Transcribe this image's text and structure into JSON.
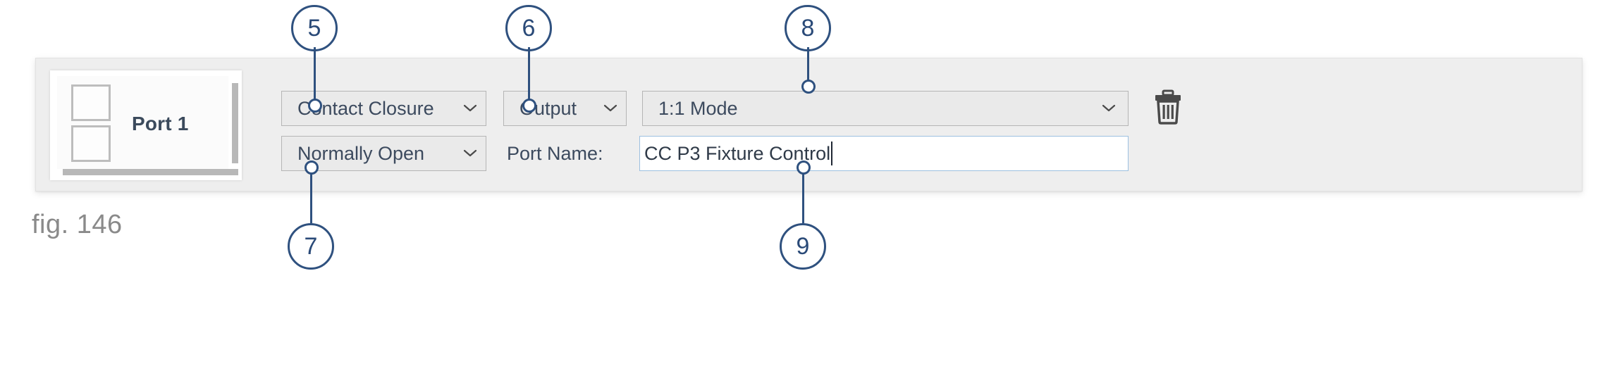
{
  "figure": {
    "caption": "fig. 146"
  },
  "panel": {
    "port_card": {
      "label": "Port 1",
      "terminal_top_name": "terminal-square-top",
      "terminal_bottom_name": "terminal-square-bottom"
    },
    "controls": {
      "type_select": {
        "value": "Contact Closure",
        "chevron": "chevron-down-icon"
      },
      "state_select": {
        "value": "Normally Open",
        "chevron": "chevron-down-icon"
      },
      "direction_select": {
        "value": "Output",
        "chevron": "chevron-down-icon"
      },
      "mode_select": {
        "value": "1:1 Mode",
        "chevron": "chevron-down-icon"
      },
      "port_name_label": "Port Name:",
      "port_name_input": {
        "value": "CC P3 Fixture Control",
        "placeholder": ""
      },
      "delete_button": {
        "icon": "trash-icon"
      }
    }
  },
  "callouts": [
    {
      "id": "5",
      "label": "5",
      "target": "type-select"
    },
    {
      "id": "6",
      "label": "6",
      "target": "direction-select"
    },
    {
      "id": "7",
      "label": "7",
      "target": "state-select"
    },
    {
      "id": "8",
      "label": "8",
      "target": "mode-select"
    },
    {
      "id": "9",
      "label": "9",
      "target": "port-name-input"
    }
  ],
  "colors": {
    "callout_blue": "#2f517f",
    "panel_background": "#eeeeee",
    "control_background": "#eaeaea",
    "control_border": "#b5b5b5",
    "input_border": "#9cc0e0",
    "text": "#3c4a5e",
    "caption": "#8a8a8a"
  }
}
